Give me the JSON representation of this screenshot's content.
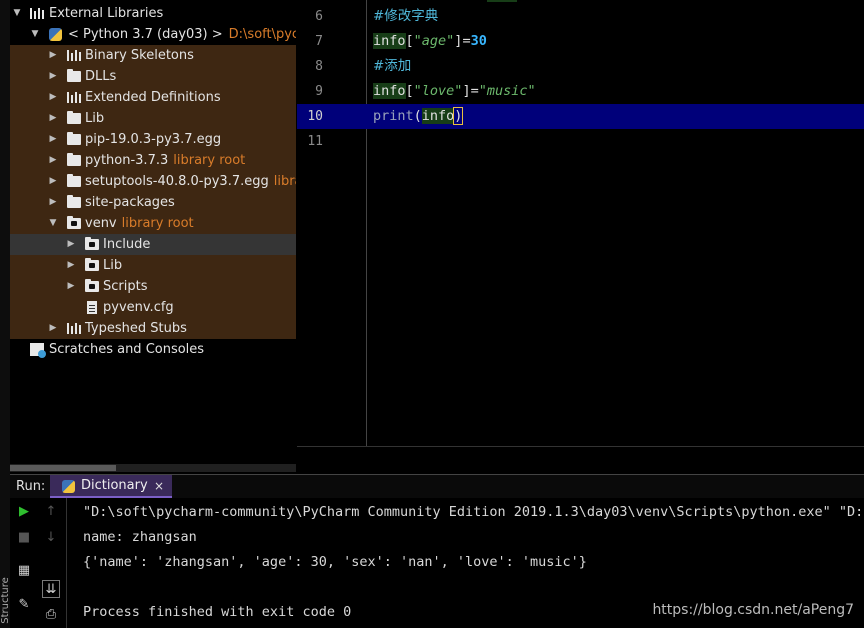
{
  "project_tree": {
    "items": [
      {
        "label": "External Libraries",
        "extra": "",
        "extra_type": ""
      },
      {
        "label": "< Python 3.7 (day03) >",
        "extra": "D:\\soft\\pycharm",
        "extra_type": "path"
      },
      {
        "label": "Binary Skeletons",
        "extra": "",
        "extra_type": ""
      },
      {
        "label": "DLLs",
        "extra": "",
        "extra_type": ""
      },
      {
        "label": "Extended Definitions",
        "extra": "",
        "extra_type": ""
      },
      {
        "label": "Lib",
        "extra": "",
        "extra_type": ""
      },
      {
        "label": "pip-19.0.3-py3.7.egg",
        "extra": "",
        "extra_type": ""
      },
      {
        "label": "python-3.7.3",
        "extra": "library root",
        "extra_type": "lr"
      },
      {
        "label": "setuptools-40.8.0-py3.7.egg",
        "extra": "library r",
        "extra_type": "lr"
      },
      {
        "label": "site-packages",
        "extra": "",
        "extra_type": ""
      },
      {
        "label": "venv",
        "extra": "library root",
        "extra_type": "lr"
      },
      {
        "label": "Include",
        "extra": "",
        "extra_type": ""
      },
      {
        "label": "Lib",
        "extra": "",
        "extra_type": ""
      },
      {
        "label": "Scripts",
        "extra": "",
        "extra_type": ""
      },
      {
        "label": "pyvenv.cfg",
        "extra": "",
        "extra_type": ""
      },
      {
        "label": "Typeshed Stubs",
        "extra": "",
        "extra_type": ""
      },
      {
        "label": "Scratches and Consoles",
        "extra": "",
        "extra_type": ""
      }
    ]
  },
  "editor": {
    "line_numbers": [
      "6",
      "7",
      "8",
      "9",
      "10",
      "11"
    ],
    "lines": {
      "l6": {
        "comment": "#修改字典"
      },
      "l7": {
        "ident": "info",
        "open": "[",
        "key": "\"age\"",
        "close": "]",
        "eq": "=",
        "num": "30"
      },
      "l8": {
        "comment": "#添加"
      },
      "l9": {
        "ident": "info",
        "open": "[",
        "key": "\"love\"",
        "close": "]",
        "eq": "=",
        "val": "\"music\""
      },
      "l10": {
        "fn": "print",
        "open": "(",
        "arg": "info",
        "close": ")"
      }
    }
  },
  "run_panel": {
    "run_label": "Run:",
    "tab_label": "Dictionary",
    "tab_close": "×",
    "output": [
      "\"D:\\soft\\pycharm-community\\PyCharm Community Edition 2019.1.3\\day03\\venv\\Scripts\\python.exe\" \"D:/s",
      "name: zhangsan",
      "{'name': 'zhangsan', 'age': 30, 'sex': 'nan', 'love': 'music'}",
      "",
      "Process finished with exit code 0"
    ],
    "side_tab": "Structure"
  },
  "watermark": "https://blog.csdn.net/aPeng7",
  "colors": {
    "accent_tab": "#7b5fc7",
    "library_root": "#d97c2a",
    "current_line": "#00007a"
  }
}
